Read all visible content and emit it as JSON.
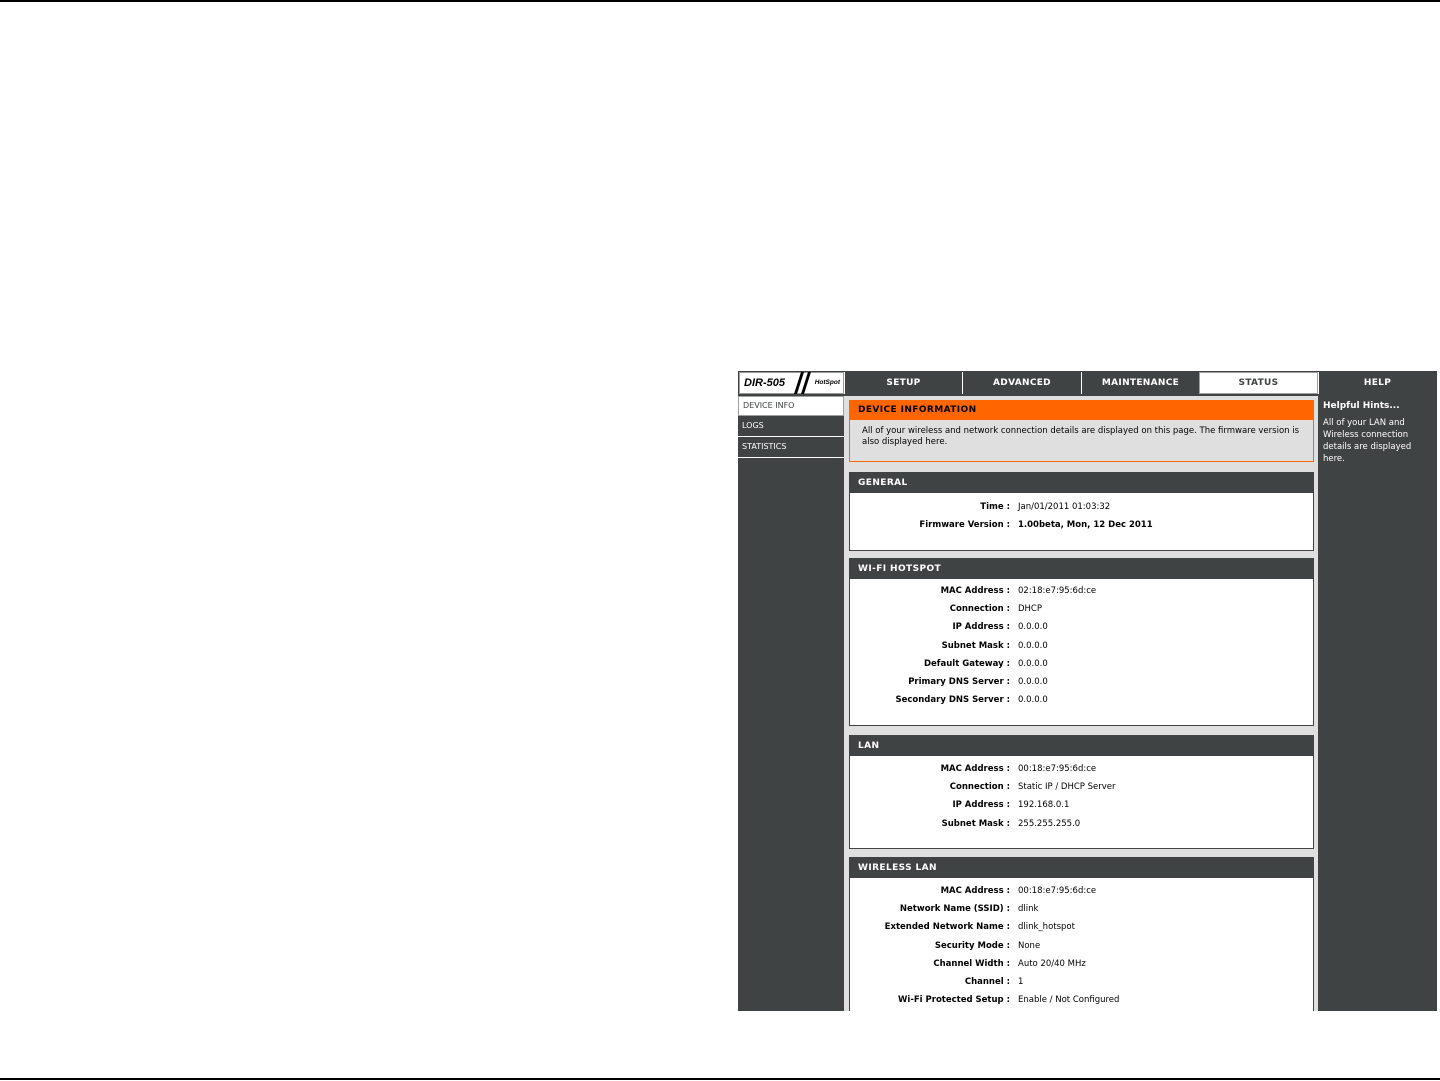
{
  "brand": {
    "model": "DIR-505",
    "product": "HotSpot"
  },
  "nav_tabs": [
    {
      "label": "SETUP"
    },
    {
      "label": "ADVANCED"
    },
    {
      "label": "MAINTENANCE"
    },
    {
      "label": "STATUS",
      "active": true
    },
    {
      "label": "HELP"
    }
  ],
  "side_nav": [
    {
      "label": "DEVICE INFO",
      "active": true
    },
    {
      "label": "LOGS"
    },
    {
      "label": "STATISTICS"
    }
  ],
  "intro": {
    "title": "DEVICE INFORMATION",
    "text": "All of your wireless and network connection details are displayed on this page. The firmware version is also displayed here."
  },
  "general": {
    "title": "GENERAL",
    "rows": [
      {
        "label": "Time :",
        "value": "Jan/01/2011 01:03:32"
      },
      {
        "label": "Firmware Version :",
        "value": "1.00beta,  Mon, 12 Dec 2011"
      }
    ]
  },
  "wifi_hotspot": {
    "title": "WI-FI HOTSPOT",
    "rows": [
      {
        "label": "MAC Address :",
        "value": "02:18:e7:95:6d:ce"
      },
      {
        "label": "Connection :",
        "value": "DHCP"
      },
      {
        "label": "IP Address :",
        "value": "0.0.0.0"
      },
      {
        "label": "Subnet Mask :",
        "value": "0.0.0.0"
      },
      {
        "label": "Default Gateway :",
        "value": "0.0.0.0"
      },
      {
        "label": "Primary DNS Server :",
        "value": "0.0.0.0"
      },
      {
        "label": "Secondary DNS Server :",
        "value": "0.0.0.0"
      }
    ]
  },
  "lan": {
    "title": "LAN",
    "rows": [
      {
        "label": "MAC Address :",
        "value": "00:18:e7:95:6d:ce"
      },
      {
        "label": "Connection :",
        "value": "Static IP / DHCP Server"
      },
      {
        "label": "IP Address :",
        "value": "192.168.0.1"
      },
      {
        "label": "Subnet Mask :",
        "value": "255.255.255.0"
      }
    ]
  },
  "wireless_lan": {
    "title": "WIRELESS LAN",
    "rows": [
      {
        "label": "MAC Address :",
        "value": "00:18:e7:95:6d:ce"
      },
      {
        "label": "Network Name (SSID) :",
        "value": "dlink"
      },
      {
        "label": "Extended Network Name :",
        "value": "dlink_hotspot"
      },
      {
        "label": "Security Mode :",
        "value": "None"
      },
      {
        "label": "Channel Width :",
        "value": "Auto 20/40 MHz"
      },
      {
        "label": "Channel :",
        "value": "1"
      },
      {
        "label": "Wi-Fi Protected Setup :",
        "value": "Enable / Not Configured"
      }
    ]
  },
  "help": {
    "title": "Helpful Hints...",
    "text": "All of your LAN and Wireless connection details are displayed here."
  },
  "colors": {
    "frame": "#404343",
    "accent": "#ff6600",
    "content_bg": "#dfdfdf"
  }
}
